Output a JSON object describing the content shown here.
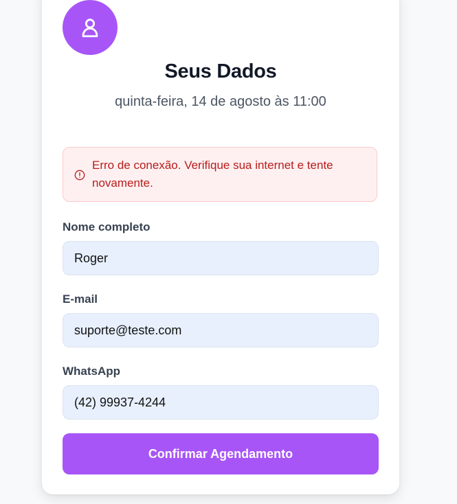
{
  "header": {
    "avatar_icon": "user-icon",
    "title": "Seus Dados",
    "subtitle": "quinta-feira, 14 de agosto às 11:00"
  },
  "alert": {
    "icon": "alert-circle-icon",
    "message": "Erro de conexão. Verifique sua internet e tente novamente."
  },
  "form": {
    "name_label": "Nome completo",
    "name_value": "Roger",
    "email_label": "E-mail",
    "email_value": "suporte@teste.com",
    "whatsapp_label": "WhatsApp",
    "whatsapp_value": "(42) 99937-4244"
  },
  "actions": {
    "confirm_label": "Confirmar Agendamento"
  },
  "colors": {
    "accent": "#a855f7",
    "error": "#b91c1c",
    "input_bg": "#e8f0fe"
  }
}
